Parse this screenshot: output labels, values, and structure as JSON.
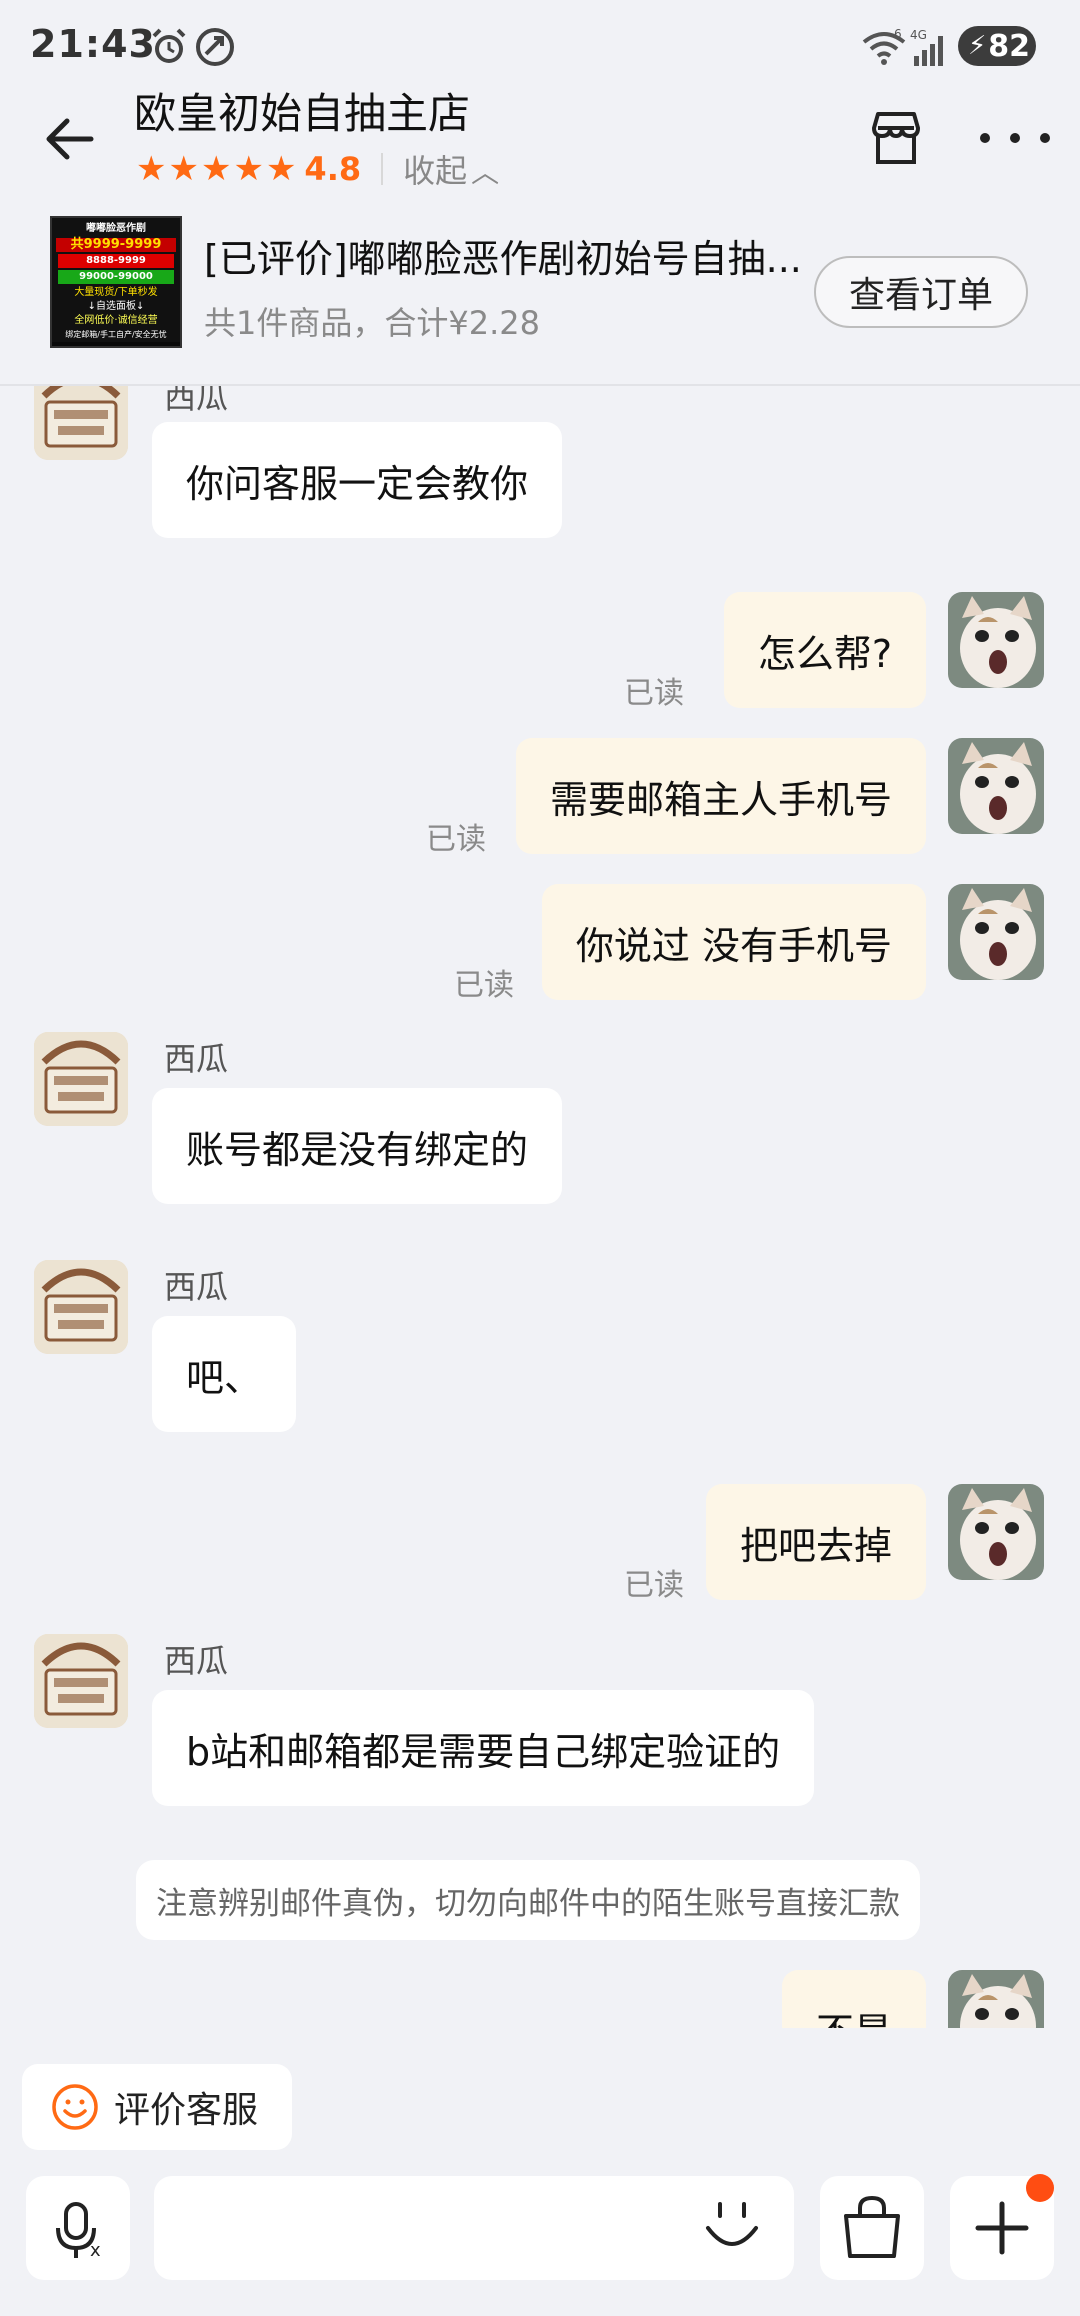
{
  "status_bar": {
    "time": "21:43",
    "battery": "82"
  },
  "header": {
    "shop_name": "欧皇初始自抽主店",
    "rating": "4.8",
    "collapse_label": "收起",
    "stars": 5
  },
  "product": {
    "title": "[已评价]嘟嘟脸恶作剧初始号自抽...",
    "summary": "共1件商品，合计¥2.28",
    "order_button": "查看订单",
    "thumb_lines": [
      "嘟嘟脸恶作剧",
      "共9999-9999",
      "8888-9999",
      "99000-99000",
      "大量现货/下单秒发",
      "↓自选面板↓",
      "全网低价·诚信经营",
      "绑定邮箱/手工自产/安全无忧"
    ]
  },
  "messages": [
    {
      "side": "in",
      "nick": "西瓜",
      "text": "你问客服一定会教你"
    },
    {
      "side": "out",
      "text": "怎么帮?",
      "status": "已读"
    },
    {
      "side": "out",
      "text": "需要邮箱主人手机号",
      "status": "已读"
    },
    {
      "side": "out",
      "text": "你说过 没有手机号",
      "status": "已读"
    },
    {
      "side": "in",
      "nick": "西瓜",
      "text": "账号都是没有绑定的"
    },
    {
      "side": "in",
      "nick": "西瓜",
      "text": "吧、"
    },
    {
      "side": "out",
      "text": "把吧去掉",
      "status": "已读"
    },
    {
      "side": "in",
      "nick": "西瓜",
      "text": "b站和邮箱都是需要自己绑定验证的"
    },
    {
      "side": "system",
      "text": "注意辨别邮件真伪，切勿向邮件中的陌生账号直接汇款"
    },
    {
      "side": "out",
      "text": "不是"
    }
  ],
  "bottom": {
    "rate_service": "评价客服",
    "input_placeholder": ""
  },
  "colors": {
    "accent": "#ff6a14",
    "out_bubble": "#fdf6e7",
    "badge": "#ff4d12"
  }
}
